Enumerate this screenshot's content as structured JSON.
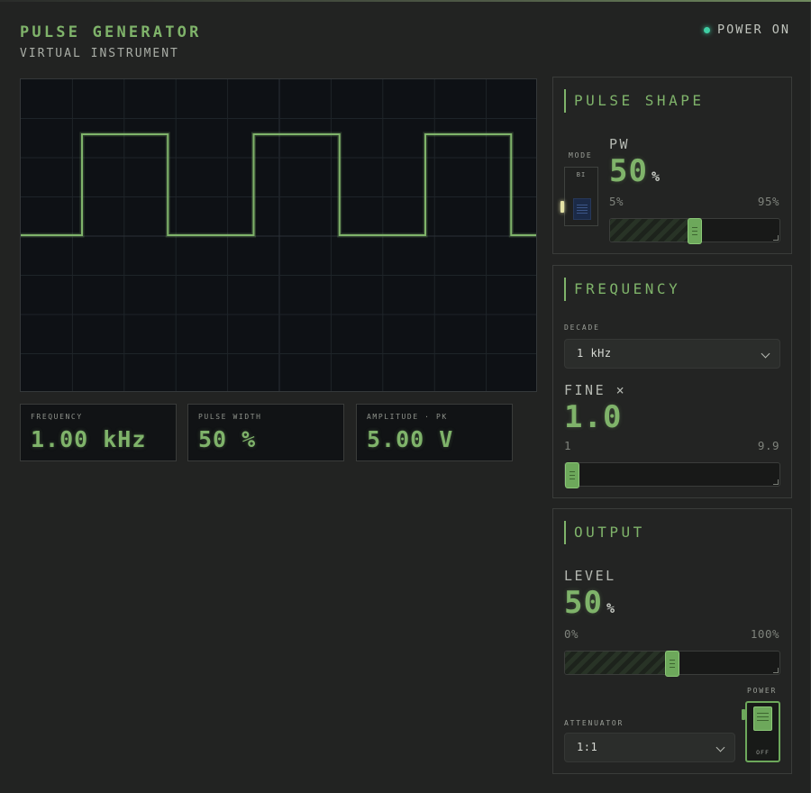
{
  "header": {
    "title": "PULSE GENERATOR",
    "subtitle": "VIRTUAL INSTRUMENT",
    "power_status": "POWER ON"
  },
  "scope": {
    "duty_cycle": 0.5,
    "cycles_visible": 3,
    "trace_color": "#7fb36a"
  },
  "readouts": {
    "frequency": {
      "label": "FREQUENCY",
      "value": "1.00 kHz"
    },
    "pulse_width": {
      "label": "PULSE WIDTH",
      "value": "50 %"
    },
    "amplitude": {
      "label": "AMPLITUDE · PK",
      "value": "5.00 V"
    }
  },
  "pulse_shape": {
    "title": "PULSE SHAPE",
    "mode_label": "MODE",
    "mode_switch_text": "BI",
    "pw_label": "PW",
    "pw_value": "50",
    "pw_unit": "%",
    "range_min": "5%",
    "range_max": "95%",
    "slider_fraction": 0.5
  },
  "frequency": {
    "title": "FREQUENCY",
    "decade_label": "DECADE",
    "decade_value": "1 kHz",
    "fine_label": "FINE ×",
    "fine_value": "1.0",
    "range_min": "1",
    "range_max": "9.9",
    "slider_fraction": 0.0
  },
  "output": {
    "title": "OUTPUT",
    "level_label": "LEVEL",
    "level_value": "50",
    "level_unit": "%",
    "range_min": "0%",
    "range_max": "100%",
    "slider_fraction": 0.5,
    "power_label": "POWER",
    "power_switch_text": "OFF",
    "attenuator_label": "ATTENUATOR",
    "attenuator_value": "1:1"
  },
  "colors": {
    "accent": "#7fb36a",
    "power_led": "#3fcfa4",
    "background": "#222322"
  }
}
